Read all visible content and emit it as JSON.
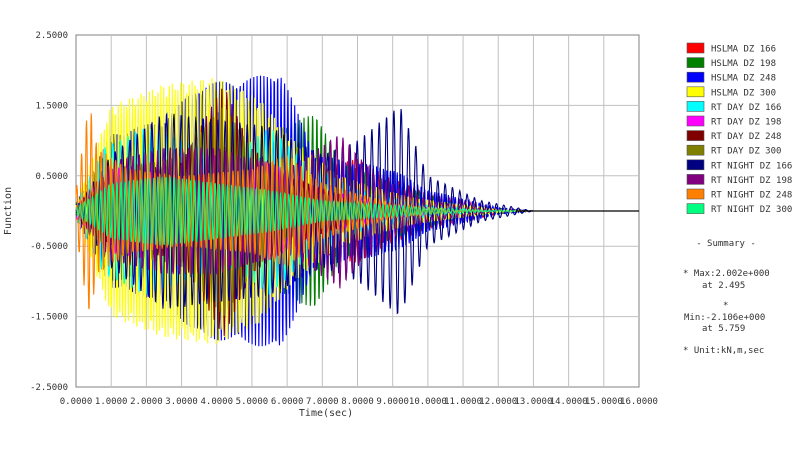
{
  "chart_data": {
    "type": "line",
    "title": "",
    "xlabel": "Time(sec)",
    "ylabel": "Function",
    "xlim": [
      0,
      16
    ],
    "ylim": [
      -2.5,
      2.5
    ],
    "grid": true,
    "legend_position": "right",
    "x_ticks": [
      "0.0000",
      "1.0000",
      "2.0000",
      "3.0000",
      "4.0000",
      "5.0000",
      "6.0000",
      "7.0000",
      "8.0000",
      "9.0000",
      "10.0000",
      "11.0000",
      "12.0000",
      "13.0000",
      "14.0000",
      "15.0000",
      "16.0000"
    ],
    "y_ticks": [
      "2.5000",
      "1.5000",
      "0.5000",
      "-0.5000",
      "-1.5000",
      "-2.5000"
    ],
    "series": [
      {
        "name": "HSLMA DZ 166",
        "color": "#ff0000",
        "envelope": [
          [
            0,
            0.1
          ],
          [
            1.0,
            0.7
          ],
          [
            2.5,
            0.9
          ],
          [
            4.0,
            0.9
          ],
          [
            5.5,
            1.0
          ],
          [
            7.0,
            0.6
          ],
          [
            8.0,
            0.75
          ],
          [
            8.8,
            0.5
          ],
          [
            10.0,
            0.25
          ],
          [
            12.0,
            0.04
          ],
          [
            13.0,
            0.0
          ]
        ],
        "freq": 6.9
      },
      {
        "name": "HSLMA DZ 198",
        "color": "#008000",
        "envelope": [
          [
            0,
            0.1
          ],
          [
            1.0,
            1.0
          ],
          [
            2.5,
            0.9
          ],
          [
            4.0,
            0.9
          ],
          [
            5.5,
            1.1
          ],
          [
            6.8,
            1.4
          ],
          [
            7.5,
            0.7
          ],
          [
            9.0,
            0.4
          ],
          [
            11.0,
            0.08
          ],
          [
            13.0,
            0.0
          ]
        ],
        "freq": 8.2
      },
      {
        "name": "HSLMA DZ 248",
        "color": "#0000ff",
        "envelope": [
          [
            0,
            0.1
          ],
          [
            1.0,
            1.1
          ],
          [
            2.5,
            1.3
          ],
          [
            3.5,
            1.8
          ],
          [
            5.0,
            1.9
          ],
          [
            5.8,
            2.0
          ],
          [
            6.8,
            0.8
          ],
          [
            9.0,
            0.6
          ],
          [
            10.0,
            0.3
          ],
          [
            12.0,
            0.05
          ],
          [
            13.0,
            0.0
          ]
        ],
        "freq": 10.3
      },
      {
        "name": "HSLMA DZ 300",
        "color": "#ffff00",
        "envelope": [
          [
            0,
            0.1
          ],
          [
            1.0,
            1.5
          ],
          [
            2.5,
            1.8
          ],
          [
            4.0,
            1.9
          ],
          [
            5.2,
            1.6
          ],
          [
            6.2,
            1.0
          ],
          [
            7.5,
            0.5
          ],
          [
            9.5,
            0.2
          ],
          [
            12.0,
            0.02
          ],
          [
            13.0,
            0.0
          ]
        ],
        "freq": 12.4
      },
      {
        "name": "RT DAY DZ 166",
        "color": "#00ffff",
        "envelope": [
          [
            0,
            0.1
          ],
          [
            0.8,
            0.9
          ],
          [
            2.0,
            1.2
          ],
          [
            3.0,
            1.0
          ],
          [
            4.5,
            0.8
          ],
          [
            5.5,
            1.2
          ],
          [
            6.5,
            0.7
          ],
          [
            8.0,
            0.3
          ],
          [
            10.0,
            0.08
          ],
          [
            12.0,
            0.0
          ]
        ],
        "freq": 4.6
      },
      {
        "name": "RT DAY DZ 198",
        "color": "#ff00ff",
        "envelope": [
          [
            0,
            0.1
          ],
          [
            1.0,
            0.6
          ],
          [
            2.5,
            0.7
          ],
          [
            4.0,
            0.8
          ],
          [
            5.5,
            0.7
          ],
          [
            7.0,
            0.3
          ],
          [
            9.0,
            0.1
          ],
          [
            11.0,
            0.0
          ]
        ],
        "freq": 5.5
      },
      {
        "name": "RT DAY DZ 248",
        "color": "#800000",
        "envelope": [
          [
            0,
            0.05
          ],
          [
            1.0,
            0.5
          ],
          [
            3.0,
            0.7
          ],
          [
            4.2,
            1.8
          ],
          [
            5.0,
            0.9
          ],
          [
            6.0,
            0.5
          ],
          [
            8.0,
            0.15
          ],
          [
            10.0,
            0.0
          ]
        ],
        "freq": 6.9
      },
      {
        "name": "RT DAY DZ 300",
        "color": "#808000",
        "envelope": [
          [
            0,
            0.05
          ],
          [
            1.0,
            0.6
          ],
          [
            3.0,
            0.8
          ],
          [
            4.2,
            1.5
          ],
          [
            5.0,
            0.9
          ],
          [
            6.0,
            0.4
          ],
          [
            8.0,
            0.1
          ],
          [
            10.0,
            0.0
          ]
        ],
        "freq": 8.3
      },
      {
        "name": "RT NIGHT DZ 166",
        "color": "#000080",
        "envelope": [
          [
            0,
            0.05
          ],
          [
            1.0,
            0.8
          ],
          [
            2.5,
            1.4
          ],
          [
            4.0,
            1.3
          ],
          [
            5.5,
            1.2
          ],
          [
            7.0,
            0.8
          ],
          [
            8.0,
            1.0
          ],
          [
            9.2,
            1.5
          ],
          [
            10.0,
            0.5
          ],
          [
            11.5,
            0.15
          ],
          [
            13.0,
            0.0
          ]
        ],
        "freq": 4.8
      },
      {
        "name": "RT NIGHT DZ 198",
        "color": "#800080",
        "envelope": [
          [
            0,
            0.05
          ],
          [
            1.0,
            0.7
          ],
          [
            2.5,
            0.9
          ],
          [
            4.0,
            0.9
          ],
          [
            6.0,
            0.6
          ],
          [
            7.5,
            1.1
          ],
          [
            8.5,
            0.5
          ],
          [
            10.0,
            0.15
          ],
          [
            12.0,
            0.0
          ]
        ],
        "freq": 5.7
      },
      {
        "name": "RT NIGHT DZ 248",
        "color": "#ff8000",
        "envelope": [
          [
            0,
            0.3
          ],
          [
            0.3,
            1.3
          ],
          [
            0.4,
            1.5
          ],
          [
            0.6,
            0.9
          ],
          [
            1.5,
            0.6
          ],
          [
            3.0,
            0.5
          ],
          [
            5.0,
            0.6
          ],
          [
            6.0,
            0.8
          ],
          [
            7.0,
            0.4
          ],
          [
            9.0,
            0.1
          ],
          [
            11.0,
            0.0
          ]
        ],
        "freq": 7.2
      },
      {
        "name": "RT NIGHT DZ 300",
        "color": "#00ff80",
        "envelope": [
          [
            0,
            0.05
          ],
          [
            1.0,
            0.4
          ],
          [
            2.5,
            0.5
          ],
          [
            4.0,
            0.4
          ],
          [
            5.5,
            0.3
          ],
          [
            7.0,
            0.15
          ],
          [
            10.0,
            0.05
          ],
          [
            12.0,
            0.0
          ]
        ],
        "freq": 8.6
      }
    ]
  },
  "summary": {
    "title": "- Summary -",
    "max_line": "* Max:2.002e+000",
    "max_at": "at  2.495",
    "star": "*",
    "min_line": "Min:-2.106e+000",
    "min_at": "at  5.759",
    "unit_line": "* Unit:kN,m,sec"
  }
}
